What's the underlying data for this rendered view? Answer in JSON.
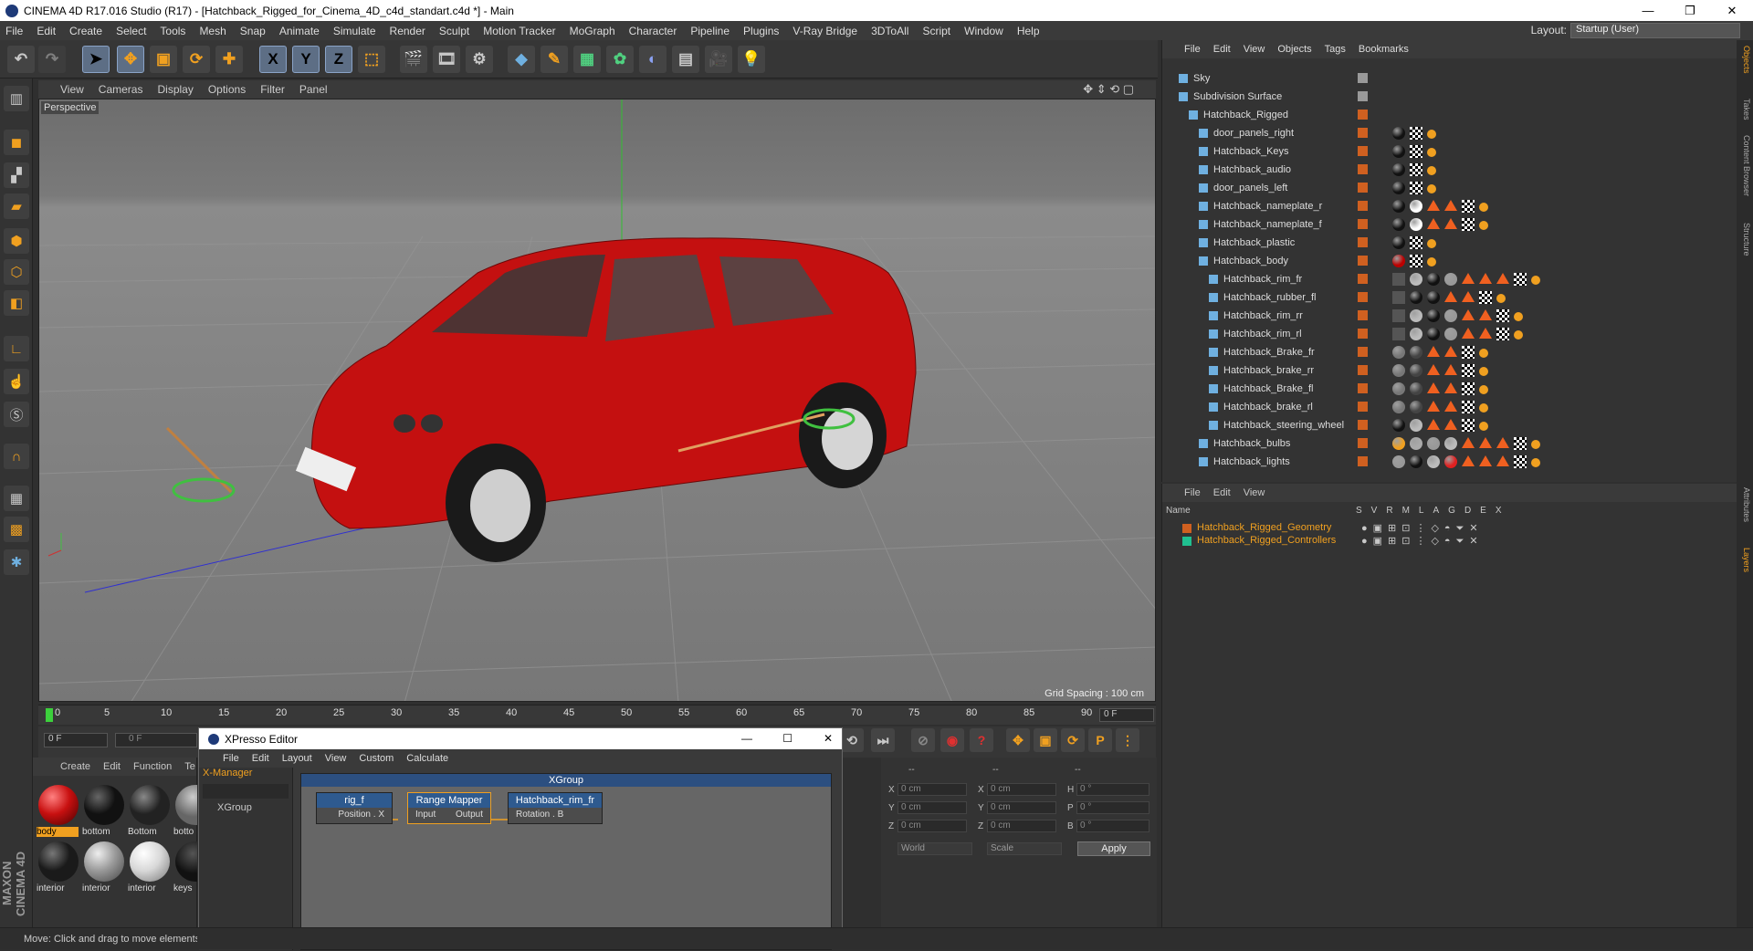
{
  "window": {
    "title": "CINEMA 4D R17.016 Studio (R17) - [Hatchback_Rigged_for_Cinema_4D_c4d_standart.c4d *] - Main"
  },
  "menubar": {
    "items": [
      "File",
      "Edit",
      "Create",
      "Select",
      "Tools",
      "Mesh",
      "Snap",
      "Animate",
      "Simulate",
      "Render",
      "Sculpt",
      "Motion Tracker",
      "MoGraph",
      "Character",
      "Pipeline",
      "Plugins",
      "V-Ray Bridge",
      "3DToAll",
      "Script",
      "Window",
      "Help"
    ],
    "layout_label": "Layout:",
    "layout_value": "Startup (User)"
  },
  "viewport": {
    "menu": [
      "View",
      "Cameras",
      "Display",
      "Options",
      "Filter",
      "Panel"
    ],
    "label": "Perspective",
    "grid_spacing": "Grid Spacing : 100 cm"
  },
  "timeline": {
    "ticks": [
      "0",
      "5",
      "10",
      "15",
      "20",
      "25",
      "30",
      "35",
      "40",
      "45",
      "50",
      "55",
      "60",
      "65",
      "70",
      "75",
      "80",
      "85",
      "90"
    ],
    "end_frame": "0 F",
    "current_frame": "0 F",
    "start_field": "0 F"
  },
  "materials": {
    "menu": [
      "Create",
      "Edit",
      "Function",
      "Te"
    ],
    "items": [
      {
        "label": "body",
        "color": "#c81010"
      },
      {
        "label": "bottom",
        "color": "#111111"
      },
      {
        "label": "Bottom",
        "color": "#222222"
      },
      {
        "label": "botto",
        "color": "#333333"
      },
      {
        "label": "interior",
        "color": "#1a1a1a"
      },
      {
        "label": "interior",
        "color": "#9a9a9a"
      },
      {
        "label": "interior",
        "color": "#d8d8d8"
      },
      {
        "label": "keys",
        "color": "#111111"
      }
    ]
  },
  "coords": {
    "headers": [
      "--",
      "--",
      "--"
    ],
    "rows": [
      {
        "a": "X",
        "av": "0 cm",
        "b": "X",
        "bv": "0 cm",
        "c": "H",
        "cv": "0 °"
      },
      {
        "a": "Y",
        "av": "0 cm",
        "b": "Y",
        "bv": "0 cm",
        "c": "P",
        "cv": "0 °"
      },
      {
        "a": "Z",
        "av": "0 cm",
        "b": "Z",
        "bv": "0 cm",
        "c": "B",
        "cv": "0 °"
      }
    ],
    "world": "World",
    "scale": "Scale",
    "apply": "Apply"
  },
  "xpresso": {
    "title": "XPresso Editor",
    "menu": [
      "File",
      "Edit",
      "Layout",
      "View",
      "Custom",
      "Calculate"
    ],
    "xmanager": "X-Manager",
    "xgroup_item": "XGroup",
    "group_title": "XGroup",
    "nodes": [
      {
        "title": "rig_f",
        "left": "",
        "right": "Position . X"
      },
      {
        "title": "Range Mapper",
        "left": "Input",
        "right": "Output"
      },
      {
        "title": "Hatchback_rim_fr",
        "left": "Rotation . B",
        "right": ""
      }
    ]
  },
  "objects": {
    "menu": [
      "File",
      "Edit",
      "View",
      "Objects",
      "Tags",
      "Bookmarks"
    ],
    "rows": [
      {
        "name": "Sky",
        "indent": 0
      },
      {
        "name": "Subdivision Surface",
        "indent": 0
      },
      {
        "name": "Hatchback_Rigged",
        "indent": 1
      },
      {
        "name": "door_panels_right",
        "indent": 2
      },
      {
        "name": "Hatchback_Keys",
        "indent": 2
      },
      {
        "name": "Hatchback_audio",
        "indent": 2
      },
      {
        "name": "door_panels_left",
        "indent": 2
      },
      {
        "name": "Hatchback_nameplate_r",
        "indent": 2
      },
      {
        "name": "Hatchback_nameplate_f",
        "indent": 2
      },
      {
        "name": "Hatchback_plastic",
        "indent": 2
      },
      {
        "name": "Hatchback_body",
        "indent": 2
      },
      {
        "name": "Hatchback_rim_fr",
        "indent": 3
      },
      {
        "name": "Hatchback_rubber_fl",
        "indent": 3
      },
      {
        "name": "Hatchback_rim_rr",
        "indent": 3
      },
      {
        "name": "Hatchback_rim_rl",
        "indent": 3
      },
      {
        "name": "Hatchback_Brake_fr",
        "indent": 3
      },
      {
        "name": "Hatchback_brake_rr",
        "indent": 3
      },
      {
        "name": "Hatchback_Brake_fl",
        "indent": 3
      },
      {
        "name": "Hatchback_brake_rl",
        "indent": 3
      },
      {
        "name": "Hatchback_steering_wheel",
        "indent": 3
      },
      {
        "name": "Hatchback_bulbs",
        "indent": 2
      },
      {
        "name": "Hatchback_lights",
        "indent": 2
      }
    ]
  },
  "layers": {
    "menu": [
      "File",
      "Edit",
      "View"
    ],
    "header_name": "Name",
    "header_cols": [
      "S",
      "V",
      "R",
      "M",
      "L",
      "A",
      "G",
      "D",
      "E",
      "X"
    ],
    "rows": [
      {
        "name": "Hatchback_Rigged_Geometry",
        "color": "#d06020"
      },
      {
        "name": "Hatchback_Rigged_Controllers",
        "color": "#20c090"
      }
    ]
  },
  "sidetabs": [
    "Objects",
    "Takes",
    "Content Browser",
    "Structure",
    "Attributes",
    "Layers"
  ],
  "status": "Move: Click and drag to move elements. Hold down SHIFT to quantize movement / add to the selection in point mode, CTRL to remove.",
  "brand": "MAXON CINEMA 4D"
}
